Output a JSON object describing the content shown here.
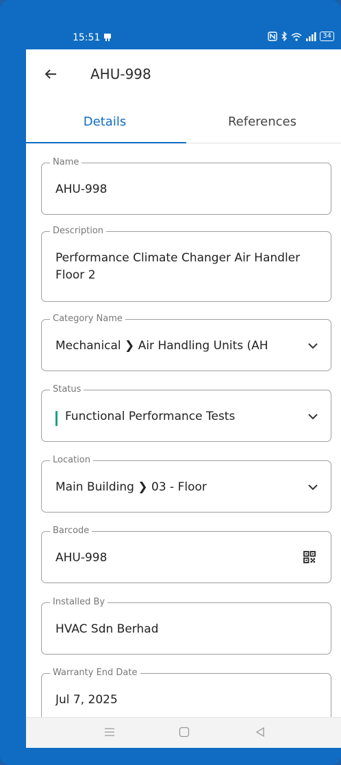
{
  "status_bar": {
    "time": "15:51",
    "battery": "34"
  },
  "app_bar": {
    "title": "AHU-998"
  },
  "tabs": [
    {
      "label": "Details",
      "active": true
    },
    {
      "label": "References",
      "active": false
    }
  ],
  "fields": {
    "name": {
      "label": "Name",
      "value": "AHU-998"
    },
    "description": {
      "label": "Description",
      "value": "Performance Climate Changer Air Handler Floor 2"
    },
    "category": {
      "label": "Category Name",
      "value": "Mechanical ❯ Air Handling Units (AH"
    },
    "status": {
      "label": "Status",
      "value": "Functional Performance Tests",
      "color": "#1aa083"
    },
    "location": {
      "label": "Location",
      "value": "Main Building ❯ 03 - Floor"
    },
    "barcode": {
      "label": "Barcode",
      "value": "AHU-998"
    },
    "installed_by": {
      "label": "Installed By",
      "value": "HVAC Sdn Berhad"
    },
    "warranty_end_date": {
      "label": "Warranty End Date",
      "value": "Jul 7, 2025"
    }
  },
  "colors": {
    "accent": "#0f6cc2",
    "status_indicator": "#1aa083"
  }
}
